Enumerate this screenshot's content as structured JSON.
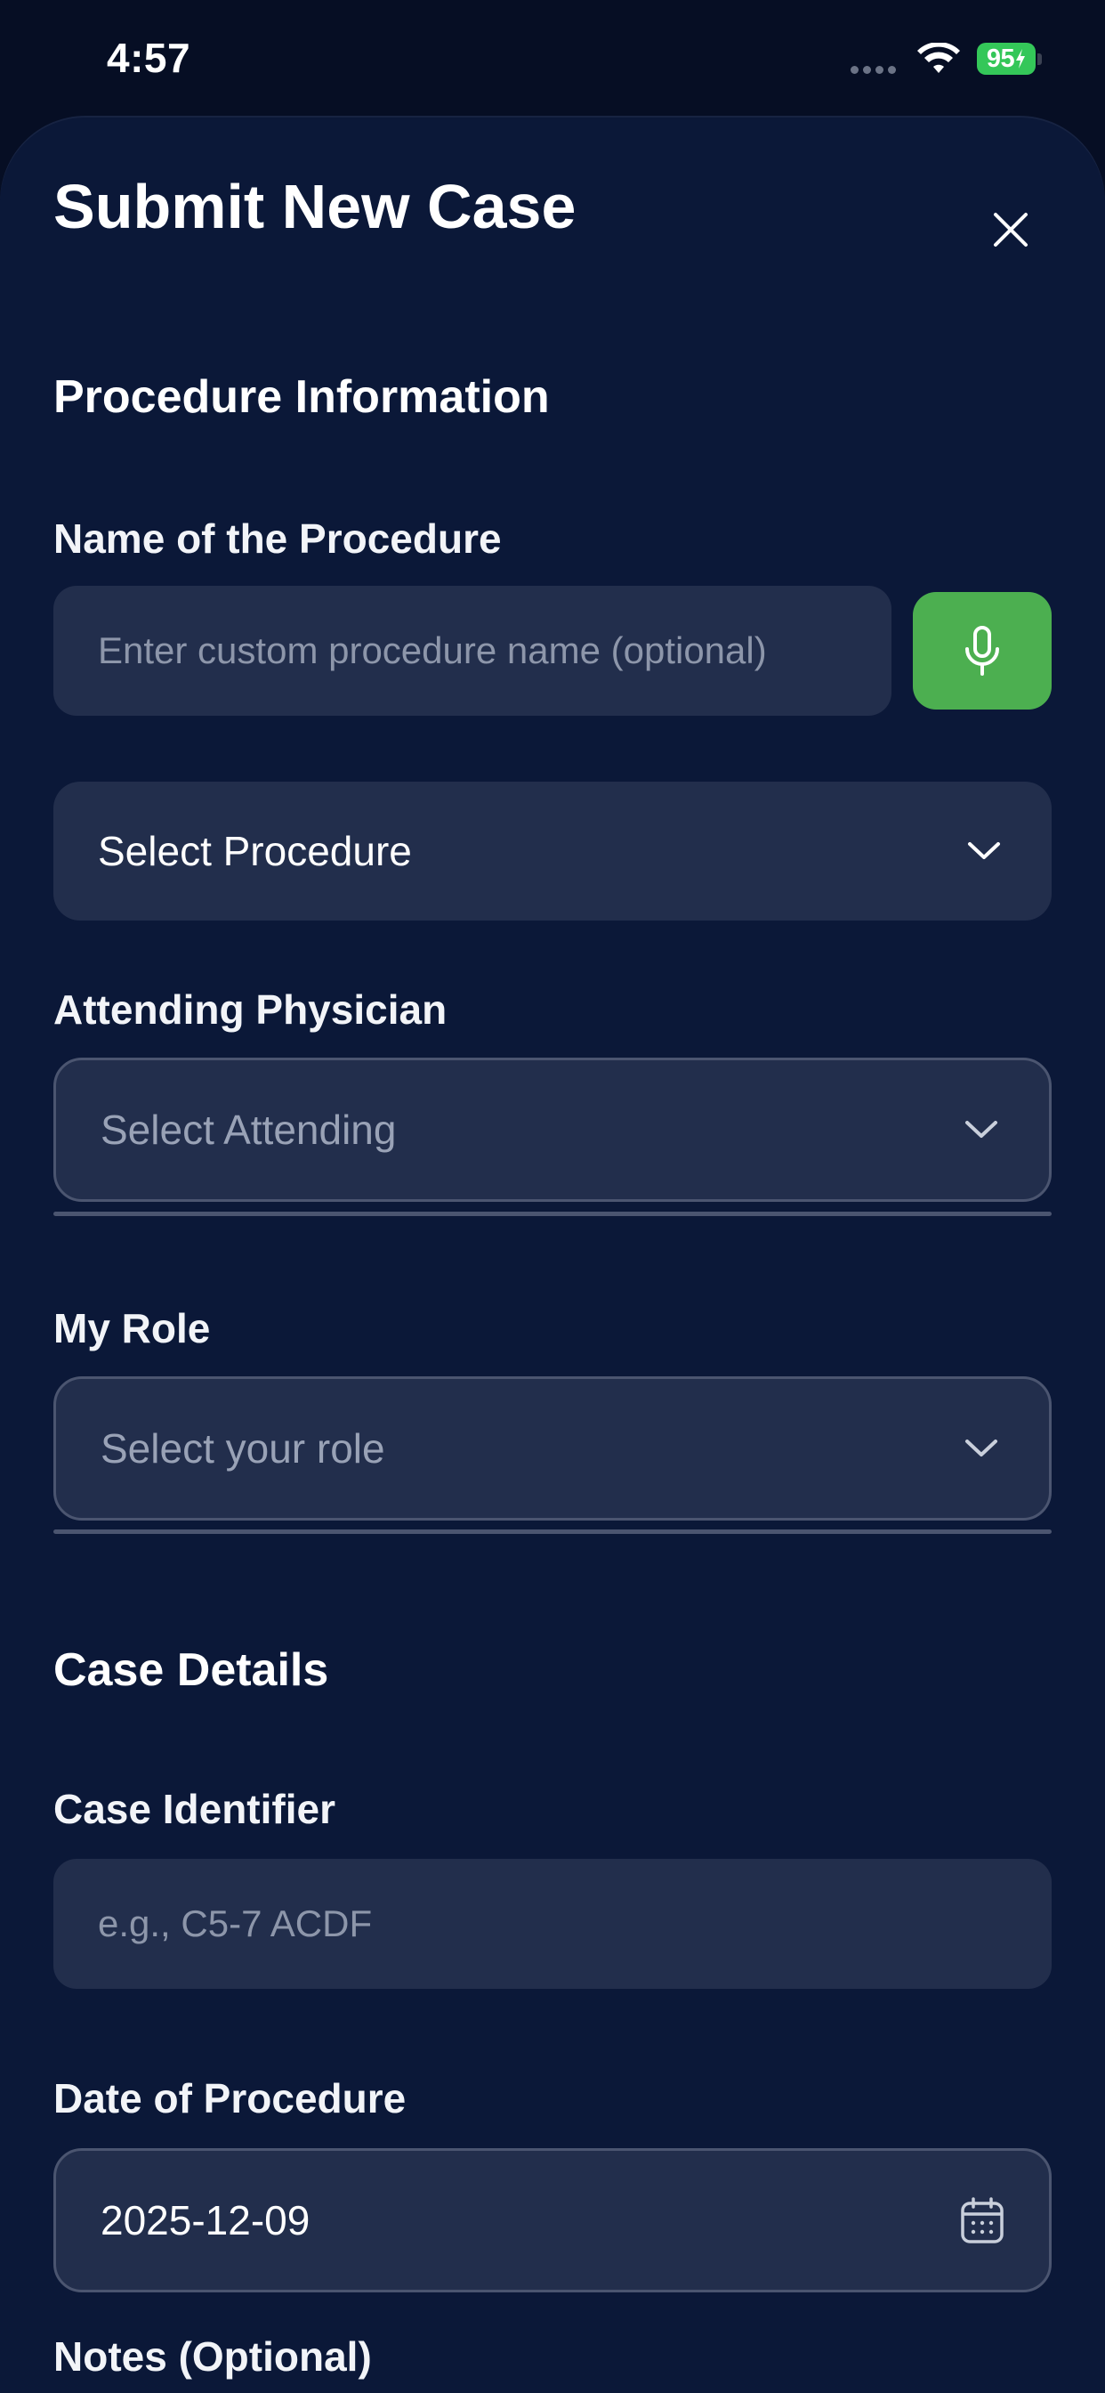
{
  "status_bar": {
    "time": "4:57",
    "battery_level": "95"
  },
  "sheet": {
    "title": "Submit New Case"
  },
  "procedure_section": {
    "heading": "Procedure Information",
    "procedure_name_label": "Name of the Procedure",
    "procedure_name_placeholder": "Enter custom procedure name (optional)",
    "procedure_select_value": "Select Procedure",
    "attending_label": "Attending Physician",
    "attending_placeholder": "Select Attending",
    "role_label": "My Role",
    "role_placeholder": "Select your role"
  },
  "case_details": {
    "heading": "Case Details",
    "case_identifier_label": "Case Identifier",
    "case_identifier_placeholder": "e.g., C5-7 ACDF",
    "date_label": "Date of Procedure",
    "date_value": "2025-12-09",
    "notes_label": "Notes (Optional)"
  },
  "colors": {
    "background": "#060e24",
    "sheet": "#0b1838",
    "field": "#222e4c",
    "accent_green": "#4caf50",
    "battery_green": "#34c759"
  },
  "icons": {
    "close": "close-icon",
    "mic": "microphone-icon",
    "dropdown": "chevron-down-icon",
    "date": "calendar-icon",
    "wifi": "wifi-icon"
  }
}
